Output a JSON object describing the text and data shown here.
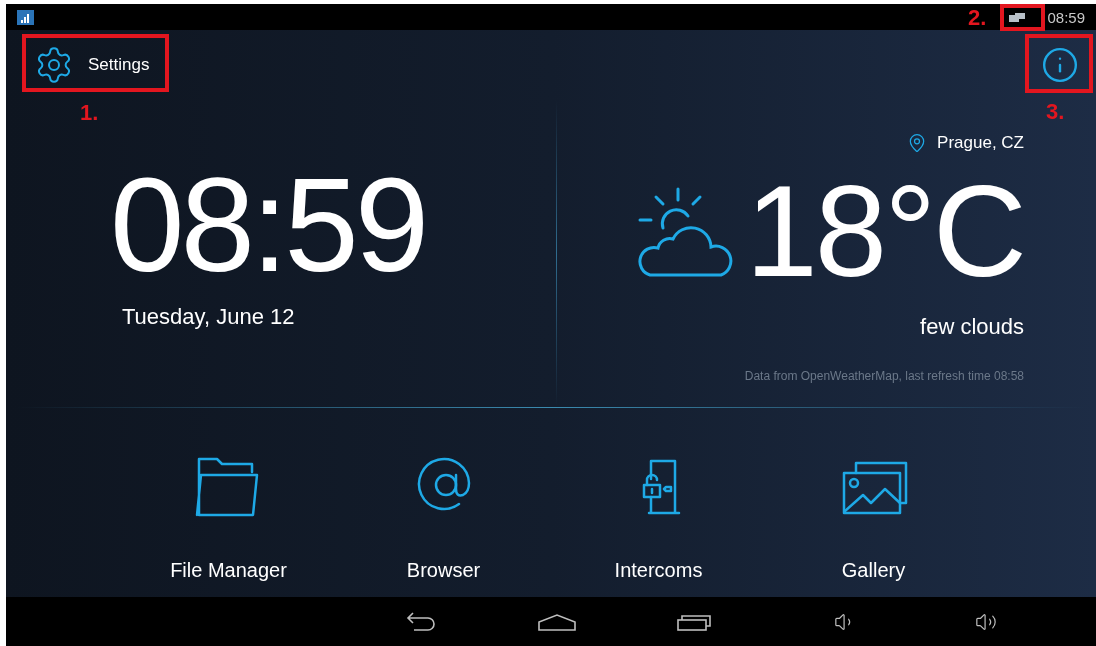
{
  "status_bar": {
    "time": "08:59"
  },
  "top_bar": {
    "settings_label": "Settings"
  },
  "clock": {
    "time": "08:59",
    "date": "Tuesday, June 12"
  },
  "weather": {
    "location": "Prague, CZ",
    "temperature": "18°C",
    "description": "few clouds",
    "source": "Data from OpenWeatherMap, last refresh time 08:58"
  },
  "apps": [
    {
      "kind": "folder",
      "label": "File Manager"
    },
    {
      "kind": "at",
      "label": "Browser"
    },
    {
      "kind": "door",
      "label": "Intercoms"
    },
    {
      "kind": "gallery",
      "label": "Gallery"
    }
  ],
  "annotations": [
    {
      "label": "1."
    },
    {
      "label": "2."
    },
    {
      "label": "3."
    }
  ]
}
